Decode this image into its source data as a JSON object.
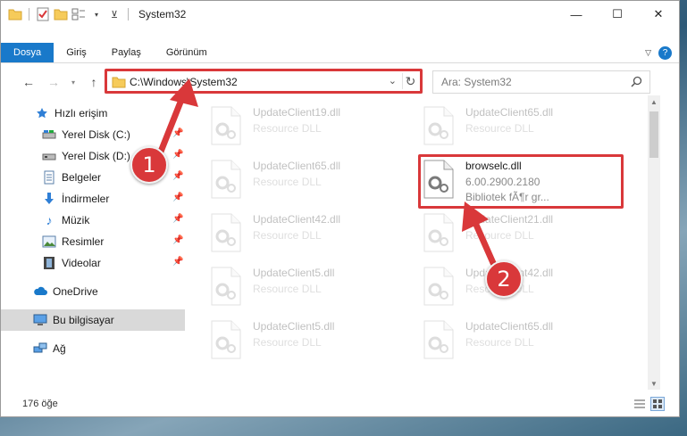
{
  "window": {
    "title": "System32",
    "controls": {
      "minimize": "—",
      "maximize": "☐",
      "close": "✕"
    }
  },
  "ribbon": {
    "tabs": [
      {
        "label": "Dosya",
        "active": true
      },
      {
        "label": "Giriş"
      },
      {
        "label": "Paylaş"
      },
      {
        "label": "Görünüm"
      }
    ]
  },
  "address": {
    "path": "C:\\Windows\\System32",
    "search_placeholder": "Ara: System32"
  },
  "sidebar": {
    "items": [
      {
        "label": "Hızlı erişim",
        "icon": "star-icon"
      },
      {
        "label": "Yerel Disk (C:)",
        "icon": "drive-icon",
        "pinned": true
      },
      {
        "label": "Yerel Disk (D:)",
        "icon": "drive-icon",
        "pinned": true
      },
      {
        "label": "Belgeler",
        "icon": "documents-icon",
        "pinned": true
      },
      {
        "label": "İndirmeler",
        "icon": "download-icon",
        "pinned": true
      },
      {
        "label": "Müzik",
        "icon": "music-icon",
        "pinned": true
      },
      {
        "label": "Resimler",
        "icon": "pictures-icon",
        "pinned": true
      },
      {
        "label": "Videolar",
        "icon": "videos-icon",
        "pinned": true
      },
      {
        "label": "OneDrive",
        "icon": "cloud-icon"
      },
      {
        "label": "Bu bilgisayar",
        "icon": "computer-icon",
        "selected": true
      },
      {
        "label": "Ağ",
        "icon": "network-icon"
      }
    ]
  },
  "files": {
    "left": [
      {
        "name": "UpdateClient19.dll",
        "type": "Resource DLL"
      },
      {
        "name": "UpdateClient65.dll",
        "type": "Resource DLL"
      },
      {
        "name": "UpdateClient42.dll",
        "type": "Resource DLL"
      },
      {
        "name": "UpdateClient5.dll",
        "type": "Resource DLL"
      },
      {
        "name": "UpdateClient5.dll",
        "type": "Resource DLL"
      }
    ],
    "right": [
      {
        "name": "UpdateClient65.dll",
        "type": "Resource DLL"
      },
      {
        "name": "browselc.dll",
        "version": "6.00.2900.2180",
        "description": "Bibliotek fÃ¶r gr...",
        "highlighted": true
      },
      {
        "name": "UpdateClient21.dll",
        "type": "Resource DLL"
      },
      {
        "name": "UpdateClient42.dll",
        "type": "Resource DLL"
      },
      {
        "name": "UpdateClient65.dll",
        "type": "Resource DLL"
      }
    ]
  },
  "status": {
    "item_count": "176 öğe"
  },
  "annotations": {
    "badge1": "1",
    "badge2": "2"
  },
  "colors": {
    "accent": "#1979ca",
    "highlight": "#d9383a"
  }
}
